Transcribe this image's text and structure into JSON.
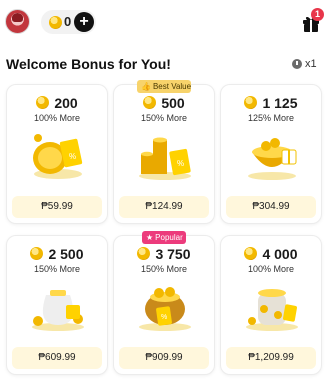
{
  "header": {
    "coin_count": "0",
    "plus_label": "+",
    "gift_badge": "1"
  },
  "page": {
    "title": "Welcome Bonus for You!",
    "multiplier": "x1"
  },
  "ribbons": {
    "best_value": "Best Value",
    "popular": "Popular"
  },
  "offers": [
    {
      "amount": "200",
      "bonus": "100% More",
      "price": "₱59.99"
    },
    {
      "amount": "500",
      "bonus": "150% More",
      "price": "₱124.99"
    },
    {
      "amount": "1 125",
      "bonus": "125% More",
      "price": "₱304.99"
    },
    {
      "amount": "2 500",
      "bonus": "150% More",
      "price": "₱609.99"
    },
    {
      "amount": "3 750",
      "bonus": "150% More",
      "price": "₱909.99"
    },
    {
      "amount": "4 000",
      "bonus": "100% More",
      "price": "₱1,209.99"
    }
  ],
  "colors": {
    "coin_gold": "#f2b800",
    "price_bg": "#fff7dc",
    "best_value_bg": "#f7d36b",
    "popular_bg": "#ec3b7c",
    "badge_red": "#e8364a"
  },
  "icons": {
    "avatar": "user-avatar",
    "coin": "coin-icon",
    "plus": "plus-icon",
    "gift": "gift-icon",
    "clock": "clock-icon",
    "thumbs_up": "thumbs-up-icon",
    "star": "star-icon"
  }
}
